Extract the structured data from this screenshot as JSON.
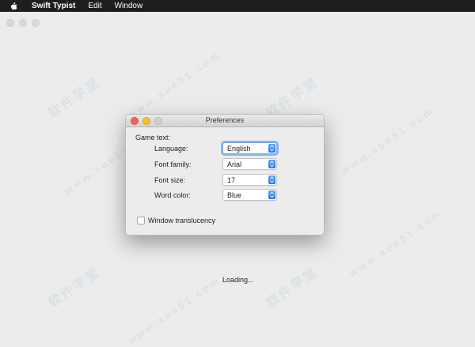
{
  "menubar": {
    "apple_icon": "apple-icon",
    "items": [
      "Swift Typist",
      "Edit",
      "Window"
    ]
  },
  "watermark": {
    "cn_text": "软件学堂",
    "url_text": "www.xue51.com"
  },
  "preferences": {
    "title": "Preferences",
    "section_label": "Game text:",
    "rows": [
      {
        "label": "Language:",
        "value": "English"
      },
      {
        "label": "Font family:",
        "value": "Arial"
      },
      {
        "label": "Font size:",
        "value": "17"
      },
      {
        "label": "Word color:",
        "value": "Blue"
      }
    ],
    "checkbox_label": "Window translucency",
    "checkbox_checked": false
  },
  "status": {
    "loading_text": "Loading..."
  },
  "colors": {
    "close": "#fc5f57",
    "minimize": "#fdbc2e",
    "accent": "#1f73e8"
  }
}
